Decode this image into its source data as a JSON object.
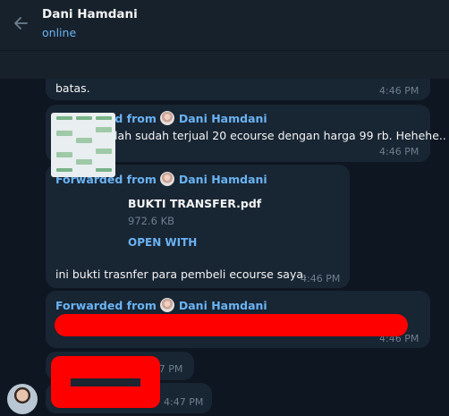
{
  "header": {
    "contact_name": "Dani Hamdani",
    "status": "online"
  },
  "messages": [
    {
      "text": "batas.",
      "time": "4:46 PM"
    },
    {
      "forwarded_label": "Forwarded from",
      "forwarded_name": "Dani Hamdani",
      "text": "Alhamdulillah sudah terjual 20 ecourse dengan harga 99 rb. Hehehe..",
      "time": "4:46 PM"
    },
    {
      "forwarded_label": "Forwarded from",
      "forwarded_name": "Dani Hamdani",
      "file": {
        "name": "BUKTI TRANSFER.pdf",
        "size": "972.6 KB",
        "action": "OPEN WITH"
      },
      "text": "ini bukti trasnfer para pembeli ecourse saya.",
      "time": "4:46 PM"
    },
    {
      "forwarded_label": "Forwarded from",
      "forwarded_name": "Dani Hamdani",
      "time": "4:46 PM"
    },
    {
      "time": "4:47 PM"
    },
    {
      "time": "4:47 PM"
    }
  ],
  "colors": {
    "background": "#0e1621",
    "header": "#17212b",
    "bubble": "#182533",
    "accent": "#6ab3f3",
    "redaction": "#ff0000"
  },
  "icons": [
    "back-arrow-icon",
    "sender-avatar-icon",
    "pdf-thumbnail-icon"
  ]
}
